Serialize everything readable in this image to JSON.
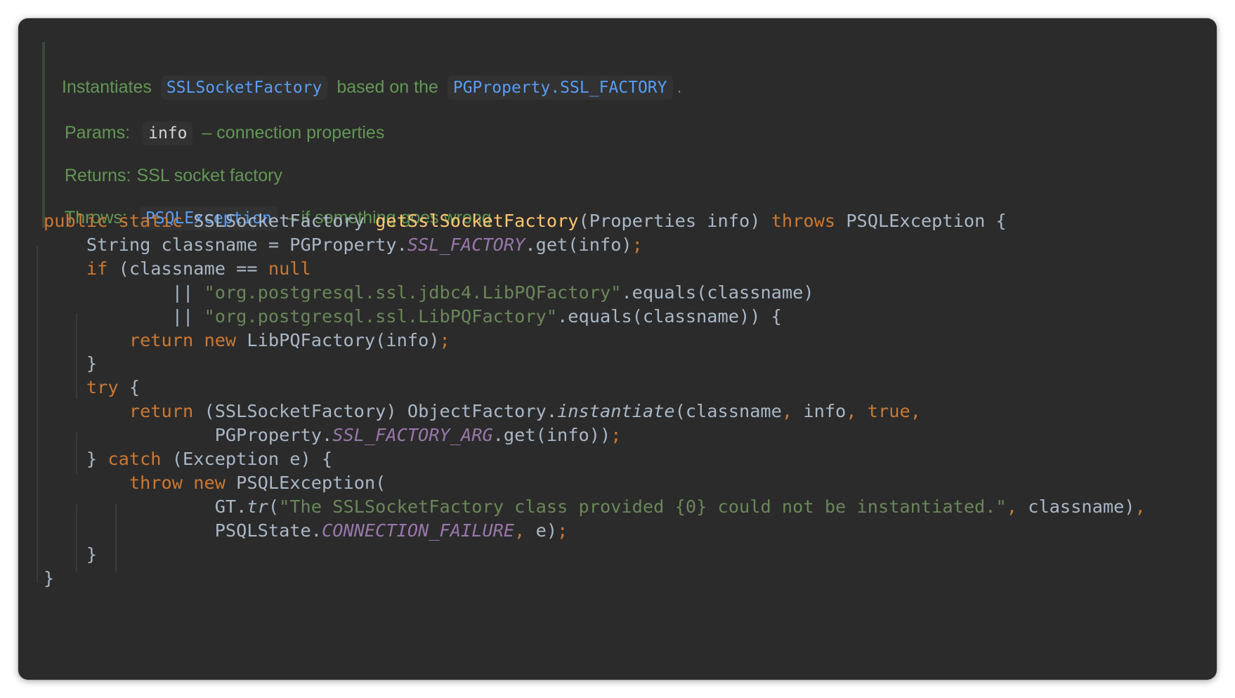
{
  "javadoc": {
    "summary": {
      "prefix": "Instantiates",
      "link1": "SSLSocketFactory",
      "middle": "based on the",
      "link2": "PGProperty.SSL_FACTORY",
      "suffix": "."
    },
    "params": {
      "label": "Params:",
      "name": "info",
      "desc": "– connection properties"
    },
    "returns": {
      "label": "Returns:",
      "desc": "SSL socket factory"
    },
    "throws": {
      "label": "Throws:",
      "type": "PSQLException",
      "desc": "– if something goes wrong"
    }
  },
  "code": {
    "l1": {
      "public": "public",
      "static": "static",
      "ret_type": "SSLSocketFactory",
      "method": "getSslSocketFactory",
      "params": "(Properties info)",
      "throws": "throws",
      "rest": "PSQLException {"
    },
    "l2": {
      "a": "String classname = PGProperty.",
      "const": "SSL_FACTORY",
      "b": ".get(info)",
      "semi": ";"
    },
    "l3": {
      "if": "if",
      "a": " (classname == ",
      "null": "null"
    },
    "l4": {
      "a": "|| ",
      "str": "\"org.postgresql.ssl.jdbc4.LibPQFactory\"",
      "b": ".equals(classname)"
    },
    "l5": {
      "a": "|| ",
      "str": "\"org.postgresql.ssl.LibPQFactory\"",
      "b": ".equals(classname)) {"
    },
    "l6": {
      "return": "return",
      "new": "new",
      "a": "LibPQFactory(info)",
      "semi": ";"
    },
    "l7": {
      "a": "}"
    },
    "l8": {
      "try": "try",
      "a": " {"
    },
    "l9": {
      "return": "return",
      "a": " (SSLSocketFactory) ObjectFactory.",
      "ital": "instantiate",
      "b": "(classname",
      "c1": ",",
      "b2": " info",
      "c2": ",",
      "true": "true",
      "c3": ","
    },
    "l10": {
      "a": "PGProperty.",
      "const": "SSL_FACTORY_ARG",
      "b": ".get(info))",
      "semi": ";"
    },
    "l11": {
      "a": "} ",
      "catch": "catch",
      "b": " (Exception e) {"
    },
    "l12": {
      "throw": "throw",
      "new": "new",
      "a": "PSQLException("
    },
    "l13": {
      "a": "GT.",
      "ital": "tr",
      "b": "(",
      "str": "\"The SSLSocketFactory class provided {0} could not be instantiated.\"",
      "c1": ",",
      "c": " classname)",
      "c2": ","
    },
    "l14": {
      "a": "PSQLState.",
      "const": "CONNECTION_FAILURE",
      "c1": ",",
      "b": " e)",
      "semi": ";"
    },
    "l15": {
      "a": "}"
    },
    "l16": {
      "a": "}"
    }
  },
  "colors": {
    "background": "#2b2b2b",
    "keyword": "#cc7832",
    "method": "#ffc66d",
    "string": "#6a8759",
    "constant": "#9876aa",
    "doc": "#629755",
    "doc_link": "#589df6",
    "text": "#a9b7c6"
  }
}
